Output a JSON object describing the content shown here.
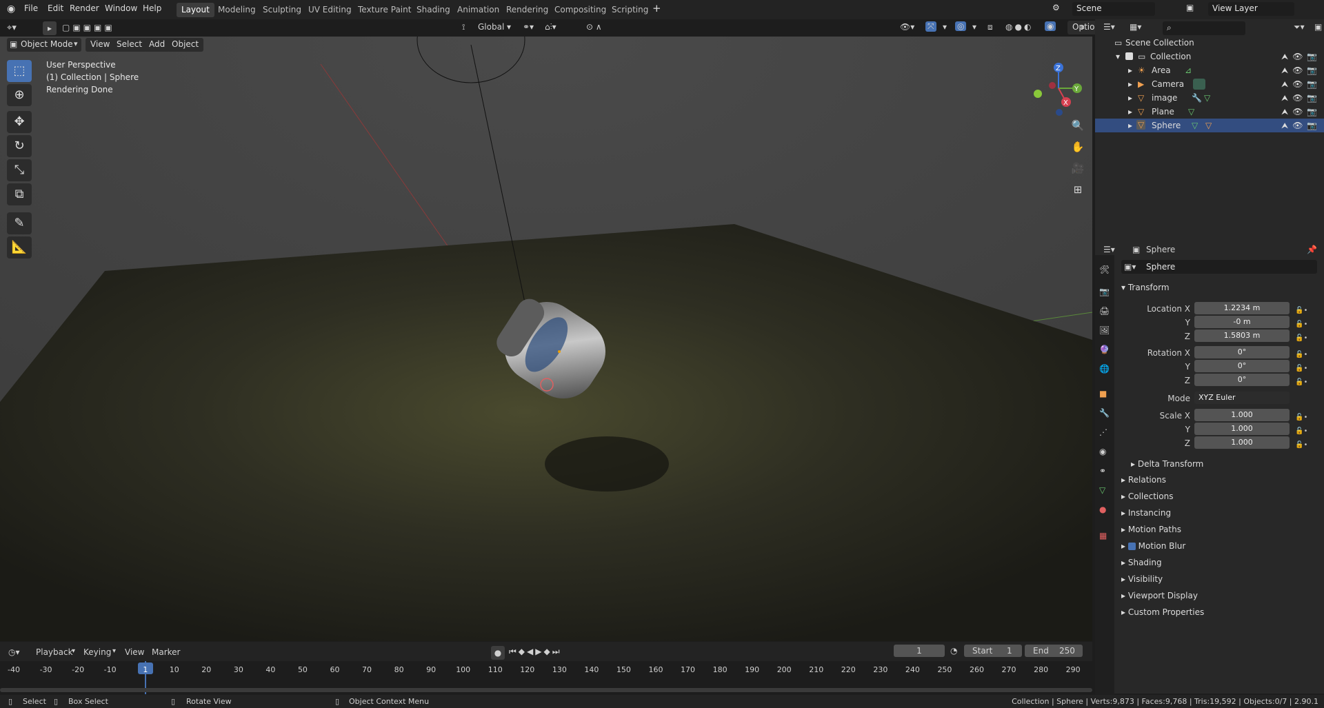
{
  "top_menu": {
    "file": "File",
    "edit": "Edit",
    "render": "Render",
    "window": "Window",
    "help": "Help"
  },
  "workspace_tabs": [
    "Layout",
    "Modeling",
    "Sculpting",
    "UV Editing",
    "Texture Paint",
    "Shading",
    "Animation",
    "Rendering",
    "Compositing",
    "Scripting"
  ],
  "active_tab": "Layout",
  "scene_name": "Scene",
  "view_layer": "View Layer",
  "viewport_header": {
    "mode": "Object Mode",
    "view": "View",
    "select": "Select",
    "add": "Add",
    "object": "Object",
    "orientation": "Global",
    "options": "Options"
  },
  "overlay": {
    "perspective": "User Perspective",
    "collection": "(1) Collection | Sphere",
    "status": "Rendering Done"
  },
  "outliner": {
    "root": "Scene Collection",
    "collection": "Collection",
    "items": [
      "Area",
      "Camera",
      "image",
      "Plane",
      "Sphere"
    ]
  },
  "properties": {
    "object_name": "Sphere",
    "data_name": "Sphere",
    "transform_label": "Transform",
    "location_x_label": "Location X",
    "location_x": "1.2234 m",
    "y_label": "Y",
    "z_label": "Z",
    "x_label": "X",
    "location_y": "-0 m",
    "location_z": "1.5803 m",
    "rotation_x_label": "Rotation X",
    "rotation_x": "0°",
    "rotation_y": "0°",
    "rotation_z": "0°",
    "mode_label": "Mode",
    "mode": "XYZ Euler",
    "scale_x_label": "Scale X",
    "scale_x": "1.000",
    "scale_y": "1.000",
    "scale_z": "1.000",
    "delta": "Delta Transform",
    "sections": [
      "Relations",
      "Collections",
      "Instancing",
      "Motion Paths",
      "Motion Blur",
      "Shading",
      "Visibility",
      "Viewport Display",
      "Custom Properties"
    ]
  },
  "timeline": {
    "playback": "Playback",
    "keying": "Keying",
    "view": "View",
    "marker": "Marker",
    "current_frame": "1",
    "start_label": "Start",
    "start": "1",
    "end_label": "End",
    "end": "250",
    "ticks": [
      "-40",
      "-30",
      "-20",
      "-10",
      "1",
      "10",
      "20",
      "30",
      "40",
      "50",
      "60",
      "70",
      "80",
      "90",
      "100",
      "110",
      "120",
      "130",
      "140",
      "150",
      "160",
      "170",
      "180",
      "190",
      "200",
      "210",
      "220",
      "230",
      "240",
      "250",
      "260",
      "270",
      "280",
      "290"
    ]
  },
  "status": {
    "select": "Select",
    "box_select": "Box Select",
    "rotate_view": "Rotate View",
    "context_menu": "Object Context Menu",
    "stats": "Collection | Sphere | Verts:9,873 | Faces:9,768 | Tris:19,592 | Objects:0/7 | 2.90.1"
  },
  "colors": {
    "accent": "#4772b3",
    "bg": "#1d1d1d",
    "panel": "#282828"
  }
}
